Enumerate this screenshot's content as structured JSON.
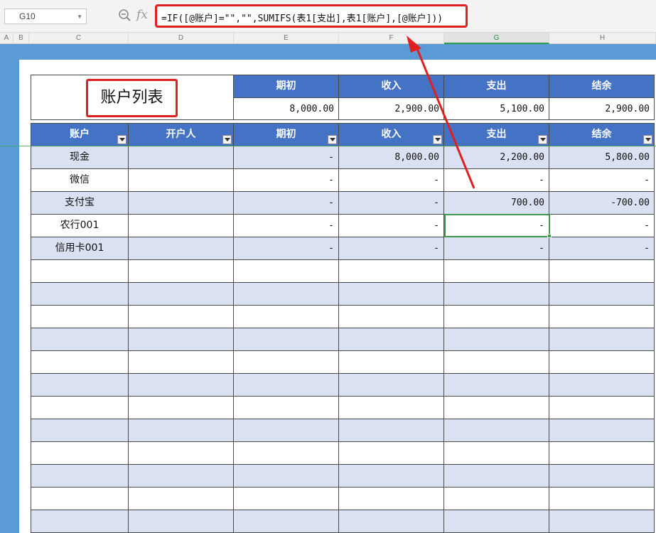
{
  "formula_bar": {
    "name_box": "G10",
    "formula": "=IF([@账户]=\"\",\"\",SUMIFS(表1[支出],表1[账户],[@账户]))"
  },
  "column_headers": [
    "A",
    "B",
    "C",
    "D",
    "E",
    "F",
    "G",
    "H"
  ],
  "active_column": "G",
  "title": "账户列表",
  "summary": {
    "headers": [
      "期初",
      "收入",
      "支出",
      "结余"
    ],
    "values": [
      "8,000.00",
      "2,900.00",
      "5,100.00",
      "2,900.00"
    ]
  },
  "table": {
    "headers": [
      "账户",
      "开户人",
      "期初",
      "收入",
      "支出",
      "结余"
    ],
    "rows": [
      {
        "account": "现金",
        "owner": "",
        "opening": "-",
        "income": "8,000.00",
        "expense": "2,200.00",
        "balance": "5,800.00"
      },
      {
        "account": "微信",
        "owner": "",
        "opening": "-",
        "income": "-",
        "expense": "-",
        "balance": "-"
      },
      {
        "account": "支付宝",
        "owner": "",
        "opening": "-",
        "income": "-",
        "expense": "700.00",
        "balance": "-700.00"
      },
      {
        "account": "农行001",
        "owner": "",
        "opening": "-",
        "income": "-",
        "expense": "-",
        "balance": "-"
      },
      {
        "account": "信用卡001",
        "owner": "",
        "opening": "-",
        "income": "-",
        "expense": "-",
        "balance": "-"
      }
    ],
    "empty_rows": 12
  },
  "colors": {
    "header_blue": "#4472c4",
    "band": "#d9e1f2",
    "frame": "#5b9bd5",
    "annotation_red": "#e02020",
    "selection_green": "#3c9a4c"
  },
  "icons": {
    "zoom": "zoom-icon",
    "fx": "function-icon",
    "filter": "filter-dropdown-icon"
  }
}
